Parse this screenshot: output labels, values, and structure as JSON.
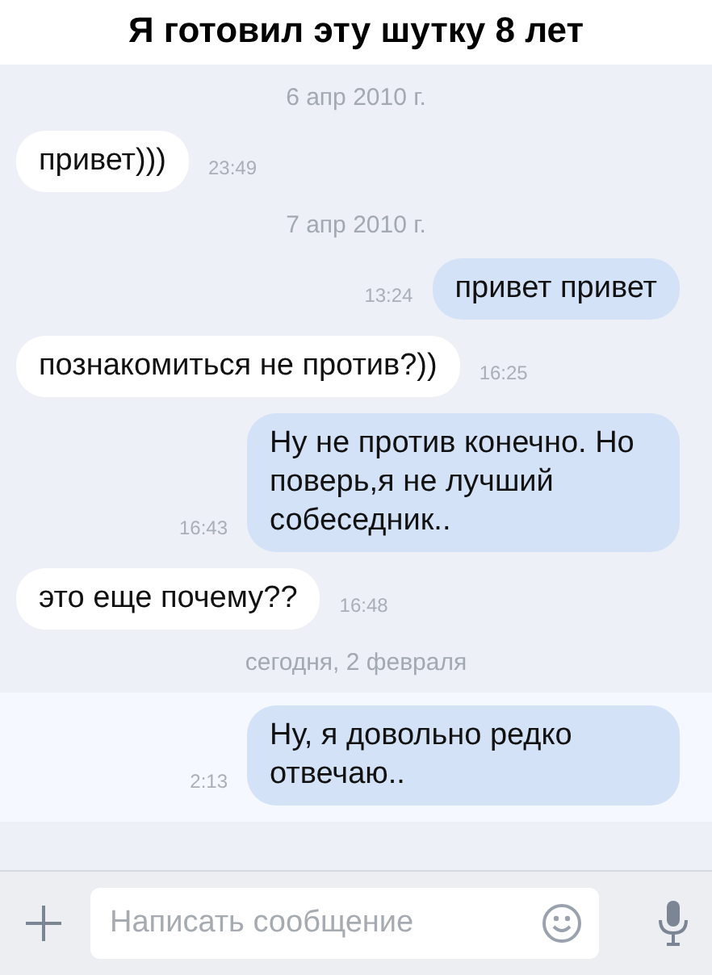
{
  "caption": "Я готовил эту шутку 8 лет",
  "messages": [
    {
      "kind": "date",
      "text": "6 апр 2010 г."
    },
    {
      "kind": "in",
      "text": "привет)))",
      "time": "23:49",
      "unread": false
    },
    {
      "kind": "date",
      "text": "7 апр 2010 г."
    },
    {
      "kind": "out",
      "text": "привет привет",
      "time": "13:24",
      "unread": false
    },
    {
      "kind": "in",
      "text": "познакомиться не против?))",
      "time": "16:25",
      "unread": false
    },
    {
      "kind": "out",
      "text": "Ну не против конечно. Но поверь,я не лучший собеседник..",
      "time": "16:43",
      "unread": false
    },
    {
      "kind": "in",
      "text": "это еще почему??",
      "time": "16:48",
      "unread": false
    },
    {
      "kind": "date",
      "text": "сегодня, 2 февраля"
    },
    {
      "kind": "out",
      "text": "Ну, я довольно редко отвечаю..",
      "time": "2:13",
      "unread": true
    }
  ],
  "composer": {
    "placeholder": "Написать сообщение"
  }
}
